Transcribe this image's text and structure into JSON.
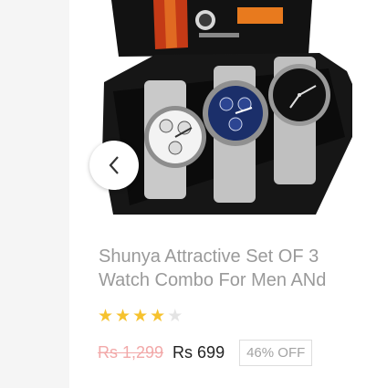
{
  "product": {
    "title": "Shunya Attractive Set OF 3 Watch Combo For Men ANd",
    "rating": {
      "value": 3.5,
      "max": 5
    },
    "mrp": "Rs 1,299",
    "price": "Rs 699",
    "discount": "46% OFF",
    "image_alt": "Set of 3 watches in black gift box"
  },
  "carousel": {
    "prev_icon": "chevron-left-icon"
  },
  "colors": {
    "star": "#f6c22e",
    "mrp": "#f2a9a9",
    "title": "#9a9a9a"
  }
}
